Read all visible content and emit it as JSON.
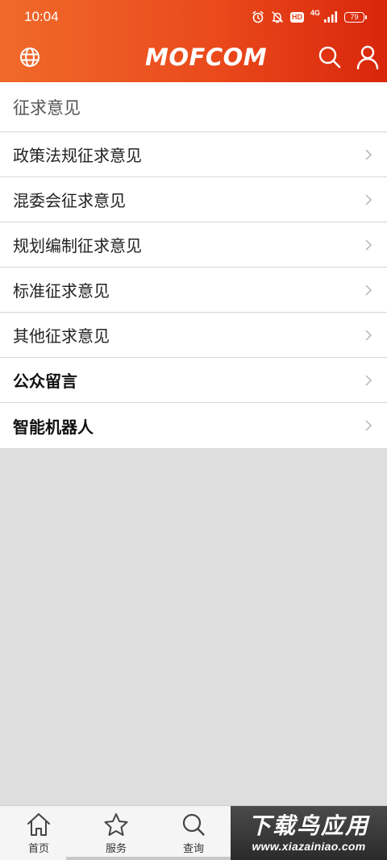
{
  "status_bar": {
    "time": "10:04",
    "hd_badge": "HD",
    "network": "4G",
    "battery": "79",
    "icons": [
      "alarm-icon",
      "bell-muted-icon",
      "signal-icon",
      "battery-icon"
    ]
  },
  "header": {
    "logo": "MOFCOM",
    "left_icon": "globe-icon",
    "right_icons": [
      "search-icon",
      "user-icon"
    ]
  },
  "section": {
    "title": "征求意见"
  },
  "menu": {
    "items": [
      {
        "label": "政策法规征求意见"
      },
      {
        "label": "混委会征求意见"
      },
      {
        "label": "规划编制征求意见"
      },
      {
        "label": "标准征求意见"
      },
      {
        "label": "其他征求意见"
      },
      {
        "label": "公众留言"
      },
      {
        "label": "智能机器人"
      }
    ]
  },
  "bottom_tabs": [
    {
      "label": "首页",
      "icon": "home-icon"
    },
    {
      "label": "服务",
      "icon": "star-icon"
    },
    {
      "label": "查询",
      "icon": "search-icon"
    }
  ],
  "watermark": {
    "title": "下载鸟应用",
    "url": "www.xiazainiao.com"
  },
  "colors": {
    "header_start": "#f06a2b",
    "header_end": "#d9260b",
    "page_bg": "#dedede",
    "divider": "#d6d6d6"
  }
}
